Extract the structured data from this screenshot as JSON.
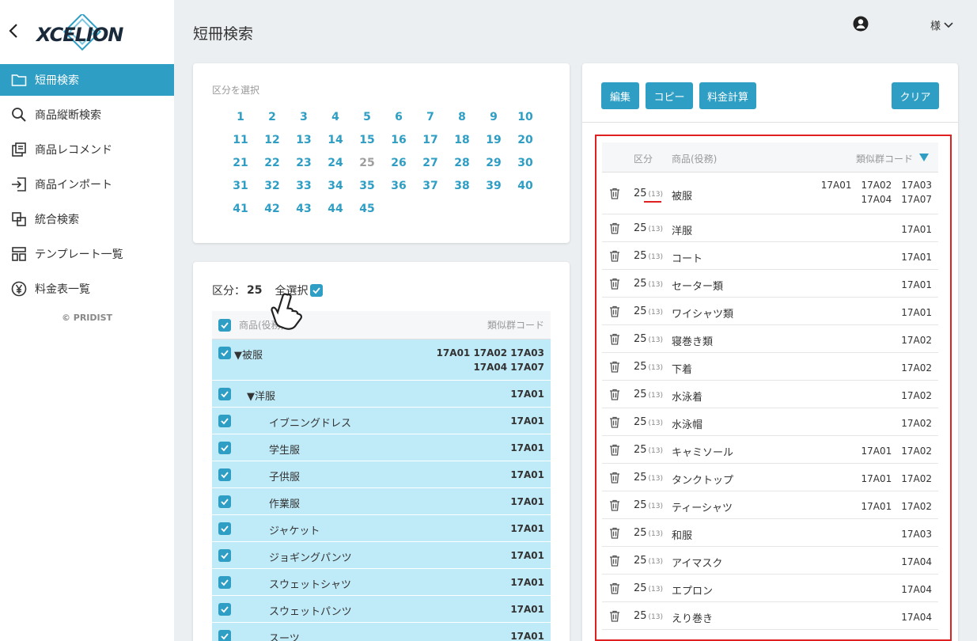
{
  "app": {
    "logo_text": "XCELION"
  },
  "sidebar": {
    "items": [
      {
        "label": "短冊検索",
        "icon": "folder-icon",
        "active": true
      },
      {
        "label": "商品縦断検索",
        "icon": "search-icon"
      },
      {
        "label": "商品レコメンド",
        "icon": "recommend-icon"
      },
      {
        "label": "商品インポート",
        "icon": "import-icon"
      },
      {
        "label": "統合検索",
        "icon": "merge-search-icon"
      },
      {
        "label": "テンプレート一覧",
        "icon": "template-icon"
      },
      {
        "label": "料金表一覧",
        "icon": "yen-icon"
      }
    ],
    "copyright": "© PRIDIST"
  },
  "header": {
    "title": "短冊検索",
    "user_suffix": "様"
  },
  "class_select": {
    "label": "区分を選択",
    "numbers": [
      "1",
      "2",
      "3",
      "4",
      "5",
      "6",
      "7",
      "8",
      "9",
      "10",
      "11",
      "12",
      "13",
      "14",
      "15",
      "16",
      "17",
      "18",
      "19",
      "20",
      "21",
      "22",
      "23",
      "24",
      "25",
      "26",
      "27",
      "28",
      "29",
      "30",
      "31",
      "32",
      "33",
      "34",
      "35",
      "36",
      "37",
      "38",
      "39",
      "40",
      "41",
      "42",
      "43",
      "44",
      "45"
    ],
    "selected": "25"
  },
  "tree": {
    "class_label": "区分：",
    "class_value": "25",
    "select_all": "全選択",
    "col_name": "商品(役務)",
    "col_code": "類似群コード",
    "rows": [
      {
        "name": "▼被服",
        "code1": "17A01 17A02 17A03",
        "code2": "17A04 17A07",
        "indent": 0
      },
      {
        "name": "▼洋服",
        "code1": "17A01",
        "code2": "",
        "indent": 1
      },
      {
        "name": "イブニングドレス",
        "code1": "17A01",
        "code2": "",
        "indent": 2
      },
      {
        "name": "学生服",
        "code1": "17A01",
        "code2": "",
        "indent": 2
      },
      {
        "name": "子供服",
        "code1": "17A01",
        "code2": "",
        "indent": 2
      },
      {
        "name": "作業服",
        "code1": "17A01",
        "code2": "",
        "indent": 2
      },
      {
        "name": "ジャケット",
        "code1": "17A01",
        "code2": "",
        "indent": 2
      },
      {
        "name": "ジョギングパンツ",
        "code1": "17A01",
        "code2": "",
        "indent": 2
      },
      {
        "name": "スウェットシャツ",
        "code1": "17A01",
        "code2": "",
        "indent": 2
      },
      {
        "name": "スウェットパンツ",
        "code1": "17A01",
        "code2": "",
        "indent": 2
      },
      {
        "name": "スーツ",
        "code1": "17A01",
        "code2": "",
        "indent": 2
      }
    ]
  },
  "right": {
    "buttons": {
      "edit": "編集",
      "copy": "コピー",
      "calc": "料金計算",
      "clear": "クリア"
    },
    "col_class": "区分",
    "col_name": "商品(役務)",
    "col_code": "類似群コード",
    "rows": [
      {
        "kb": "25",
        "sub": "(13)",
        "name": "被服",
        "code1": "17A01　17A02　17A03",
        "code2": "17A04　17A07"
      },
      {
        "kb": "25",
        "sub": "(13)",
        "name": "洋服",
        "code1": "17A01",
        "code2": ""
      },
      {
        "kb": "25",
        "sub": "(13)",
        "name": "コート",
        "code1": "17A01",
        "code2": ""
      },
      {
        "kb": "25",
        "sub": "(13)",
        "name": "セーター類",
        "code1": "17A01",
        "code2": ""
      },
      {
        "kb": "25",
        "sub": "(13)",
        "name": "ワイシャツ類",
        "code1": "17A01",
        "code2": ""
      },
      {
        "kb": "25",
        "sub": "(13)",
        "name": "寝巻き類",
        "code1": "17A02",
        "code2": ""
      },
      {
        "kb": "25",
        "sub": "(13)",
        "name": "下着",
        "code1": "17A02",
        "code2": ""
      },
      {
        "kb": "25",
        "sub": "(13)",
        "name": "水泳着",
        "code1": "17A02",
        "code2": ""
      },
      {
        "kb": "25",
        "sub": "(13)",
        "name": "水泳帽",
        "code1": "17A02",
        "code2": ""
      },
      {
        "kb": "25",
        "sub": "(13)",
        "name": "キャミソール",
        "code1": "17A01　17A02",
        "code2": ""
      },
      {
        "kb": "25",
        "sub": "(13)",
        "name": "タンクトップ",
        "code1": "17A01　17A02",
        "code2": ""
      },
      {
        "kb": "25",
        "sub": "(13)",
        "name": "ティーシャツ",
        "code1": "17A01　17A02",
        "code2": ""
      },
      {
        "kb": "25",
        "sub": "(13)",
        "name": "和服",
        "code1": "17A03",
        "code2": ""
      },
      {
        "kb": "25",
        "sub": "(13)",
        "name": "アイマスク",
        "code1": "17A04",
        "code2": ""
      },
      {
        "kb": "25",
        "sub": "(13)",
        "name": "エプロン",
        "code1": "17A04",
        "code2": ""
      },
      {
        "kb": "25",
        "sub": "(13)",
        "name": "えり巻き",
        "code1": "17A04",
        "code2": ""
      }
    ]
  },
  "colors": {
    "accent": "#2e9ec4",
    "row_selected": "#bfeaf7",
    "highlight_border": "#e02020"
  }
}
